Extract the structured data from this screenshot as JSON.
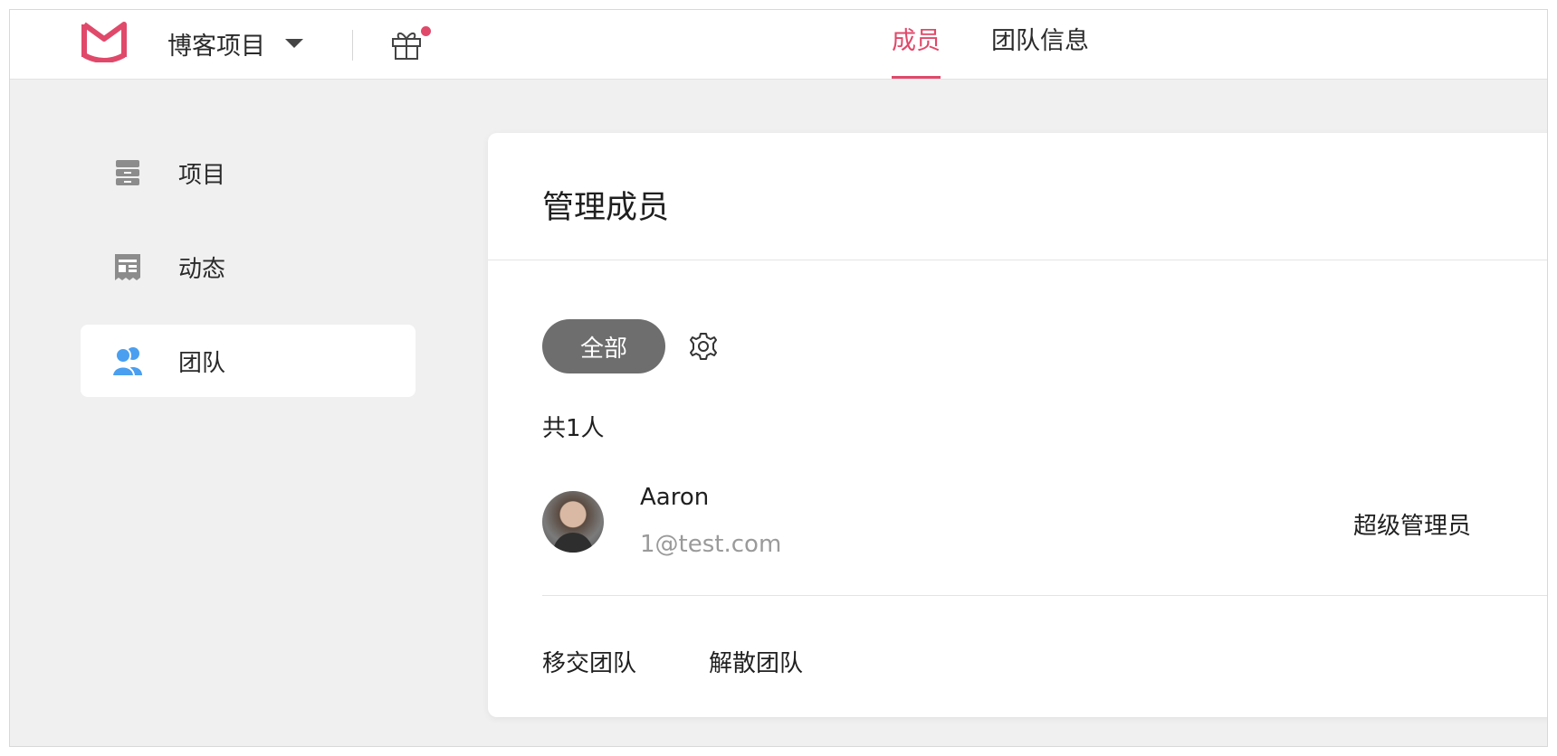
{
  "header": {
    "project_name": "博客项目",
    "tabs": [
      {
        "label": "成员",
        "active": true
      },
      {
        "label": "团队信息",
        "active": false
      }
    ],
    "gift_has_notification": true,
    "accent_color": "#e0496a"
  },
  "sidebar": {
    "items": [
      {
        "label": "项目",
        "icon": "archive-icon",
        "active": false
      },
      {
        "label": "动态",
        "icon": "newspaper-icon",
        "active": false
      },
      {
        "label": "团队",
        "icon": "users-icon",
        "active": true
      }
    ]
  },
  "main": {
    "title": "管理成员",
    "filter_label": "全部",
    "count_text": "共1人",
    "members": [
      {
        "name": "Aaron",
        "email": "1@test.com",
        "role": "超级管理员"
      }
    ],
    "actions": [
      "移交团队",
      "解散团队"
    ]
  }
}
